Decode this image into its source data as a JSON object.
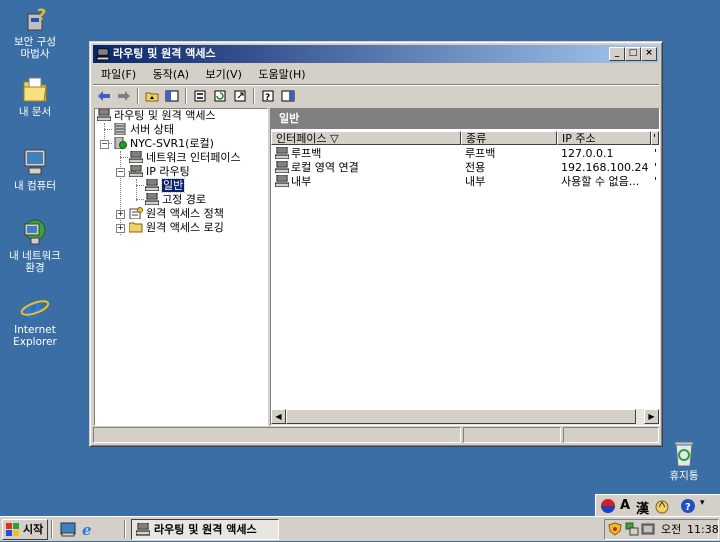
{
  "desktop": {
    "icons": [
      {
        "label": "보안 구성\n마법사",
        "icon": "security-wizard-icon"
      },
      {
        "label": "내 문서",
        "icon": "my-documents-icon"
      },
      {
        "label": "내 컴퓨터",
        "icon": "my-computer-icon"
      },
      {
        "label": "내 네트워크\n환경",
        "icon": "my-network-icon"
      },
      {
        "label": "Internet\nExplorer",
        "icon": "internet-explorer-icon"
      },
      {
        "label": "휴지통",
        "icon": "recycle-bin-icon"
      }
    ]
  },
  "window": {
    "title": "라우팅 및 원격 액세스",
    "menu": [
      "파일(F)",
      "동작(A)",
      "보기(V)",
      "도움말(H)"
    ],
    "toolbar_icons": [
      "back-icon",
      "forward-icon",
      "up-icon",
      "show-hide-tree-icon",
      "properties-icon",
      "refresh-icon",
      "export-icon",
      "help-icon",
      "show-hide-action-icon"
    ]
  },
  "tree": {
    "root": "라우팅 및 원격 액세스",
    "server_status": "서버 상태",
    "server": "NYC-SVR1(로컬)",
    "network_interfaces": "네트워크 인터페이스",
    "ip_routing": "IP 라우팅",
    "general": "일반",
    "static_routes": "고정 경로",
    "remote_access_policy": "원격 액세스 정책",
    "remote_access_logging": "원격 액세스 로깅"
  },
  "detail": {
    "header": "일반",
    "columns": [
      "인터페이스 ▽",
      "종류",
      "IP 주소",
      "'"
    ],
    "rows": [
      {
        "name": "루프백",
        "type": "루프백",
        "ip": "127.0.0.1",
        "extra": "'"
      },
      {
        "name": "로컬 영역 연결",
        "type": "전용",
        "ip": "192.168.100.24",
        "extra": "'"
      },
      {
        "name": "내부",
        "type": "내부",
        "ip": "사용할 수 없음...",
        "extra": "'"
      }
    ]
  },
  "langbar": {
    "ime": "A",
    "hanja": "漢"
  },
  "taskbar": {
    "start": "시작",
    "task": "라우팅 및 원격 액세스",
    "ime": "오전",
    "time": "11:38"
  }
}
